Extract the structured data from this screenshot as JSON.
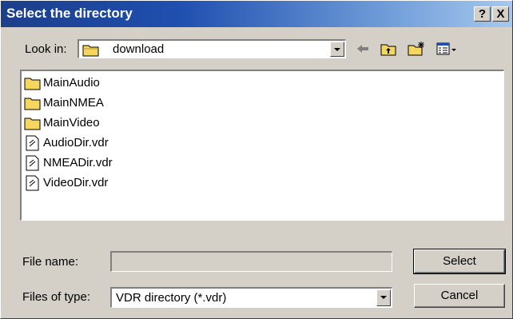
{
  "window": {
    "title": "Select the directory",
    "help_label": "?",
    "close_label": "X"
  },
  "lookin": {
    "label": "Look in:",
    "value": "download"
  },
  "toolbar": {
    "back_icon": "back-arrow-icon",
    "up_icon": "up-one-level-icon",
    "newfolder_icon": "new-folder-icon",
    "view_icon": "view-menu-icon"
  },
  "files": [
    {
      "name": "MainAudio",
      "type": "folder"
    },
    {
      "name": "MainNMEA",
      "type": "folder"
    },
    {
      "name": "MainVideo",
      "type": "folder"
    },
    {
      "name": "AudioDir.vdr",
      "type": "file"
    },
    {
      "name": "NMEADir.vdr",
      "type": "file"
    },
    {
      "name": "VideoDir.vdr",
      "type": "file"
    }
  ],
  "filename": {
    "label": "File name:",
    "value": ""
  },
  "filetype": {
    "label": "Files of type:",
    "value": "VDR directory (*.vdr)"
  },
  "buttons": {
    "select": "Select",
    "cancel": "Cancel"
  },
  "colors": {
    "title_start": "#1c3f8a",
    "title_end": "#a6c8ee",
    "folder_yellow": "#f5d760"
  }
}
